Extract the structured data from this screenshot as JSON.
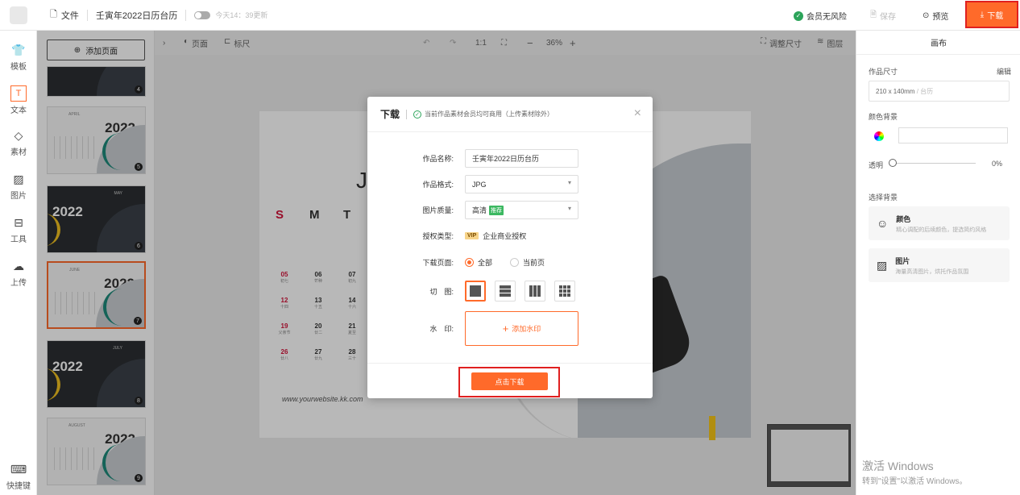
{
  "topbar": {
    "file_label": "文件",
    "doc_title": "壬寅年2022日历台历",
    "autosave": "今天14：39更新",
    "risk": "会员无风险",
    "save": "保存",
    "preview": "预览",
    "download": "下载"
  },
  "leftnav": [
    {
      "label": "模板",
      "icon": "template-icon"
    },
    {
      "label": "文本",
      "icon": "text-icon"
    },
    {
      "label": "素材",
      "icon": "material-icon"
    },
    {
      "label": "图片",
      "icon": "image-icon"
    },
    {
      "label": "工具",
      "icon": "toolbox-icon"
    },
    {
      "label": "上传",
      "icon": "upload-icon"
    }
  ],
  "shortcut_label": "快捷键",
  "thumbs": {
    "add_page": "添加页面",
    "items": [
      {
        "num": "4",
        "year": "",
        "month": "",
        "style": "dark"
      },
      {
        "num": "5",
        "year": "2022",
        "month": "APRIL",
        "style": "light"
      },
      {
        "num": "6",
        "year": "2022",
        "month": "MAY",
        "style": "dark"
      },
      {
        "num": "7",
        "year": "2022",
        "month": "JUNE",
        "style": "light"
      },
      {
        "num": "8",
        "year": "2022",
        "month": "JULY",
        "style": "dark"
      },
      {
        "num": "9",
        "year": "2022",
        "month": "AUGUST",
        "style": "light"
      }
    ]
  },
  "toolbar2": {
    "page": "页面",
    "ruler": "标尺",
    "ratio": "1:1",
    "zoom": "36%",
    "resize": "调整尺寸",
    "layers": "图层"
  },
  "canvas": {
    "big_letter": "J",
    "weekdays": [
      "S",
      "M",
      "T"
    ],
    "days": [
      {
        "d": "05",
        "s": "初七",
        "red": true
      },
      {
        "d": "06",
        "s": "芒种",
        "red": false
      },
      {
        "d": "07",
        "s": "初九",
        "red": false
      },
      {
        "d": "12",
        "s": "十四",
        "red": true
      },
      {
        "d": "13",
        "s": "十五",
        "red": false
      },
      {
        "d": "14",
        "s": "十六",
        "red": false
      },
      {
        "d": "19",
        "s": "父亲节",
        "red": true
      },
      {
        "d": "20",
        "s": "廿二",
        "red": false
      },
      {
        "d": "21",
        "s": "夏至",
        "red": false
      },
      {
        "d": "26",
        "s": "廿八",
        "red": true
      },
      {
        "d": "27",
        "s": "廿九",
        "red": false
      },
      {
        "d": "28",
        "s": "三十",
        "red": false
      }
    ],
    "website": "www.yourwebsite.kk.com"
  },
  "rpanel": {
    "title": "画布",
    "size_label": "作品尺寸",
    "edit": "编辑",
    "size_value": "210 x 140mm",
    "size_unit": "/ 台历",
    "bg_color_label": "颜色背景",
    "opacity_label": "透明",
    "opacity_value": "0%",
    "choose_bg_label": "选择背景",
    "color_title": "颜色",
    "color_desc": "精心调配的后续颜色，提选简约风格",
    "image_title": "图片",
    "image_desc": "海量高清图片，烘托作品氛围"
  },
  "modal": {
    "title": "下载",
    "subtitle": "当前作品素材会员均可商用（上传素材除外）",
    "name_label": "作品名称:",
    "name_value": "壬寅年2022日历台历",
    "format_label": "作品格式:",
    "format_value": "JPG",
    "quality_label": "图片质量:",
    "quality_value": "高清",
    "quality_tag": "推荐",
    "license_label": "授权类型:",
    "license_tag": "VIP",
    "license_value": "企业商业授权",
    "pages_label": "下载页面:",
    "pages_all": "全部",
    "pages_current": "当前页",
    "cut_label": "切　图:",
    "watermark_label": "水　印:",
    "watermark_btn": "添加水印",
    "download_btn": "点击下载"
  },
  "windows": {
    "activate": "激活 Windows",
    "hint": "转到\"设置\"以激活 Windows。"
  },
  "colors": {
    "accent": "#ff6a2a",
    "alert": "#e02020",
    "success": "#2ca45a"
  }
}
